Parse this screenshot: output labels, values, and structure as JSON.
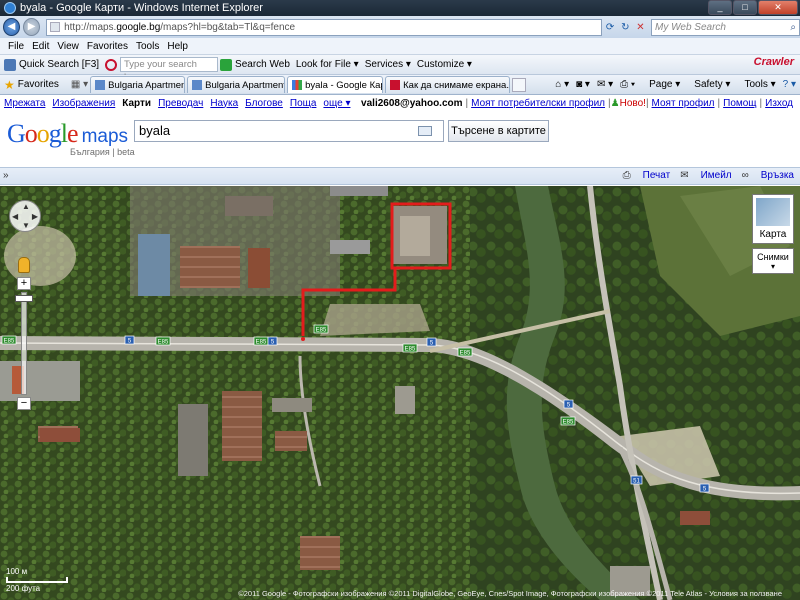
{
  "window": {
    "title": "byala - Google Карти - Windows Internet Explorer"
  },
  "address": {
    "url_prefix": "http://maps.",
    "url_domain": "google.bg",
    "url_rest": "/maps?hl=bg&tab=Tl&q=fence",
    "search_placeholder": "My Web Search"
  },
  "menu": {
    "items": [
      "File",
      "Edit",
      "View",
      "Favorites",
      "Tools",
      "Help"
    ]
  },
  "toolbar": {
    "quick_search": "Quick Search [F3]",
    "search_placeholder": "Type your search here...",
    "search_web": "Search Web",
    "look_for_file": "Look for File",
    "services": "Services",
    "customize": "Customize",
    "crawler": "Crawler"
  },
  "tabsbar": {
    "favorites": "Favorites",
    "tabs": [
      {
        "label": "Bulgaria Apartments::Cont...",
        "active": false
      },
      {
        "label": "Bulgaria Apartments::Cont...",
        "active": false
      },
      {
        "label": "byala - Google Карти",
        "active": true
      },
      {
        "label": "Как да снимаме екрана. /...",
        "active": false
      }
    ],
    "page": "Page",
    "safety": "Safety",
    "tools": "Tools"
  },
  "gbar": {
    "links": [
      "Мрежата",
      "Изображения"
    ],
    "current": "Карти",
    "links_after": [
      "Преводач",
      "Наука",
      "Блогове",
      "Поща",
      "още ▾"
    ],
    "user": "vali2608@yahoo.com",
    "my_profile_link": "Моят потребителски профил",
    "novo": "Ново!",
    "my_profile2": "Моят профил",
    "help": "Помощ",
    "exit": "Изход"
  },
  "header": {
    "logo_sub": "България | beta",
    "query": "byala",
    "search_button": "Търсене в картите"
  },
  "subbar": {
    "print": "Печат",
    "email": "Имейл",
    "link": "Връзка"
  },
  "map": {
    "map_type": "Карта",
    "photos": "Снимки",
    "scale_m": "100 м",
    "scale_ft": "200 фута",
    "copyright": "©2011 Google - Фотографски изображения ©2011 DigitalGlobe, GeoEye, Cnes/Spot Image, Фотографски изображения ©2011 Tele Atlas - Условия за ползване",
    "route_labels": [
      "E85",
      "E85",
      "E85",
      "E85",
      "E85",
      "E85",
      "E85"
    ],
    "road_numbers": [
      "5",
      "5",
      "5",
      "5",
      "5",
      "51"
    ]
  }
}
